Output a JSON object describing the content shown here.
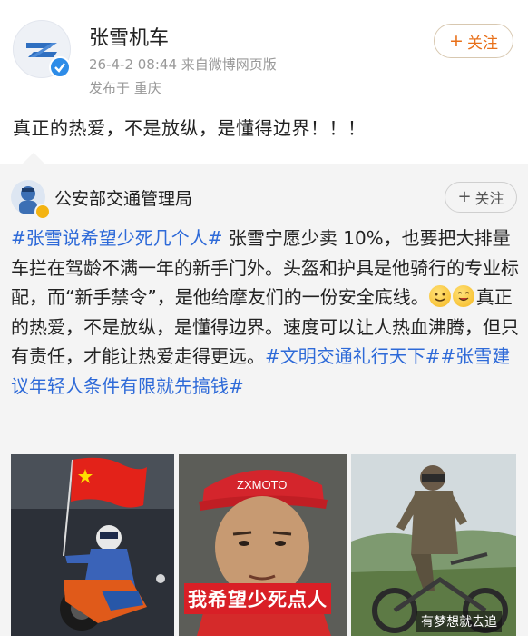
{
  "author": {
    "name": "张雪机车",
    "time_source": "26-4-2 08:44  来自微博网页版",
    "location": "发布于 重庆",
    "follow_label": "关注",
    "avatar_icon": "zhangxue-z-logo-icon",
    "verified_icon": "verified-check-icon"
  },
  "post": {
    "text": "真正的热爱，不是放纵，是懂得边界！！！"
  },
  "repost": {
    "name": "公安部交通管理局",
    "follow_label": "关注",
    "body": {
      "tag1": "#张雪说希望少死几个人#",
      "text1": " 张雪宁愿少卖 10%，也要把大排量车拦在驾龄不满一年的新手门外。头盔和护具是他骑行的专业标配，而“新手禁令”，是他给摩友们的一份安全底线。",
      "text2": "真正的热爱，不是放纵，是懂得边界。速度可以让人热血沸腾，但只有责任，才能让热爱走得更远。",
      "tag2": "#文明交通礼行天下#",
      "tag3": "#张雪建议年轻人条件有限就先搞钱#"
    },
    "images": [
      {
        "name": "racer-with-flag-photo"
      },
      {
        "name": "man-in-cap-photo",
        "caption": "我希望少死点人",
        "cap_brand": "ZXMOTO"
      },
      {
        "name": "rider-on-dirt-bike-photo",
        "caption": "有梦想就去追"
      }
    ]
  },
  "colors": {
    "accent_orange": "#e8701a",
    "link_blue": "#2e6ad8",
    "verified_blue": "#2d8ce8",
    "gold_badge": "#f3b312",
    "caption_red": "#d91f26"
  }
}
